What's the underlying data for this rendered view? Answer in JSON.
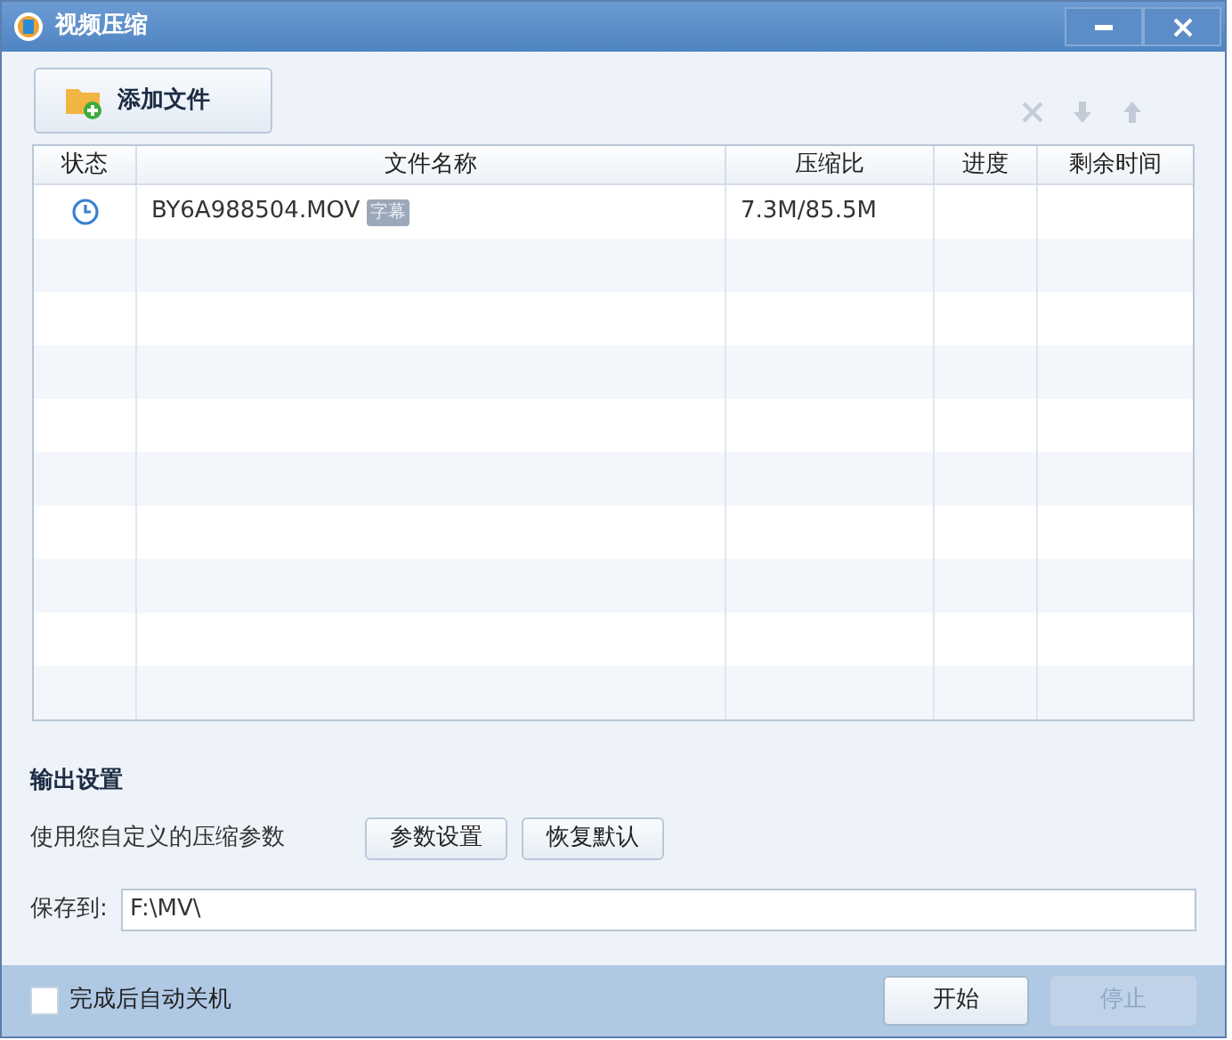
{
  "window": {
    "title": "视频压缩"
  },
  "toolbar": {
    "add_button": "添加文件",
    "actions": [
      {
        "kind": "delete",
        "disabled": true
      },
      {
        "kind": "down",
        "disabled": true
      },
      {
        "kind": "up",
        "disabled": true
      }
    ]
  },
  "table": {
    "columns": [
      "状态",
      "文件名称",
      "压缩比",
      "进度",
      "剩余时间"
    ],
    "rows": [
      {
        "kind": "waiting",
        "name": "BY6A988504.MOV",
        "tag": "字幕",
        "ratio": "7.3M/85.5M"
      }
    ]
  },
  "output": {
    "heading": "输出设置",
    "description": "使用您自定义的压缩参数",
    "buttons": [
      "参数设置",
      "恢复默认"
    ],
    "save_label": "保存到:",
    "save_value": "F:\\MV\\"
  },
  "footer": {
    "checkbox": {
      "label": "完成后自动关机",
      "checked": false
    },
    "buttons": [
      {
        "label": "开始",
        "disabled": false
      },
      {
        "label": "停止",
        "disabled": true
      }
    ]
  }
}
